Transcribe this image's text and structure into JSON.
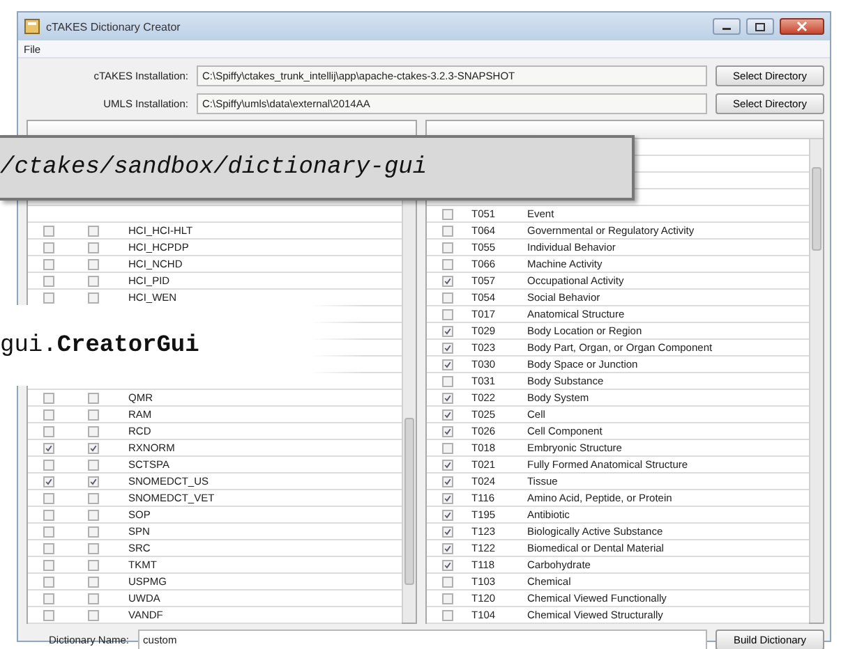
{
  "window": {
    "title": "cTAKES Dictionary Creator"
  },
  "menu": [
    "File"
  ],
  "installations": [
    {
      "label": "cTAKES Installation:",
      "value": "C:\\Spiffy\\ctakes_trunk_intellij\\app\\apache-ctakes-3.2.3-SNAPSHOT",
      "button": "Select Directory"
    },
    {
      "label": "UMLS Installation:",
      "value": "C:\\Spiffy\\umls\\data\\external\\2014AA",
      "button": "Select Directory"
    }
  ],
  "source_table": {
    "rows_upper": [
      {
        "name": "HCI_HCI-HLT",
        "checked_1": false,
        "checked_2": false
      },
      {
        "name": "HCI_HCPDP",
        "checked_1": false,
        "checked_2": false
      },
      {
        "name": "HCI_NCHD",
        "checked_1": false,
        "checked_2": false
      },
      {
        "name": "HCI_PID",
        "checked_1": false,
        "checked_2": false
      },
      {
        "name": "HCI_WEN",
        "checked_1": false,
        "checked_2": false
      }
    ],
    "rows_lower": [
      {
        "name": "QMR",
        "checked_1": false,
        "checked_2": false
      },
      {
        "name": "RAM",
        "checked_1": false,
        "checked_2": false
      },
      {
        "name": "RCD",
        "checked_1": false,
        "checked_2": false
      },
      {
        "name": "RXNORM",
        "checked_1": true,
        "checked_2": true
      },
      {
        "name": "SCTSPA",
        "checked_1": false,
        "checked_2": false
      },
      {
        "name": "SNOMEDCT_US",
        "checked_1": true,
        "checked_2": true
      },
      {
        "name": "SNOMEDCT_VET",
        "checked_1": false,
        "checked_2": false
      },
      {
        "name": "SOP",
        "checked_1": false,
        "checked_2": false
      },
      {
        "name": "SPN",
        "checked_1": false,
        "checked_2": false
      },
      {
        "name": "SRC",
        "checked_1": false,
        "checked_2": false
      },
      {
        "name": "TKMT",
        "checked_1": false,
        "checked_2": false
      },
      {
        "name": "USPMG",
        "checked_1": false,
        "checked_2": false
      },
      {
        "name": "UWDA",
        "checked_1": false,
        "checked_2": false
      },
      {
        "name": "VANDF",
        "checked_1": false,
        "checked_2": false
      }
    ]
  },
  "type_table": {
    "rows": [
      {
        "tui": "T051",
        "name": "Event",
        "checked": false
      },
      {
        "tui": "T064",
        "name": "Governmental or Regulatory Activity",
        "checked": false
      },
      {
        "tui": "T055",
        "name": "Individual Behavior",
        "checked": false
      },
      {
        "tui": "T066",
        "name": "Machine Activity",
        "checked": false
      },
      {
        "tui": "T057",
        "name": "Occupational Activity",
        "checked": true
      },
      {
        "tui": "T054",
        "name": "Social Behavior",
        "checked": false
      },
      {
        "tui": "T017",
        "name": "Anatomical Structure",
        "checked": false
      },
      {
        "tui": "T029",
        "name": "Body Location or Region",
        "checked": true
      },
      {
        "tui": "T023",
        "name": "Body Part, Organ, or Organ Component",
        "checked": true
      },
      {
        "tui": "T030",
        "name": "Body Space or Junction",
        "checked": true
      },
      {
        "tui": "T031",
        "name": "Body Substance",
        "checked": false
      },
      {
        "tui": "T022",
        "name": "Body System",
        "checked": true
      },
      {
        "tui": "T025",
        "name": "Cell",
        "checked": true
      },
      {
        "tui": "T026",
        "name": "Cell Component",
        "checked": true
      },
      {
        "tui": "T018",
        "name": "Embryonic Structure",
        "checked": false
      },
      {
        "tui": "T021",
        "name": "Fully Formed Anatomical Structure",
        "checked": true
      },
      {
        "tui": "T024",
        "name": "Tissue",
        "checked": true
      },
      {
        "tui": "T116",
        "name": "Amino Acid, Peptide, or Protein",
        "checked": true
      },
      {
        "tui": "T195",
        "name": "Antibiotic",
        "checked": true
      },
      {
        "tui": "T123",
        "name": "Biologically Active Substance",
        "checked": true
      },
      {
        "tui": "T122",
        "name": "Biomedical or Dental Material",
        "checked": true
      },
      {
        "tui": "T118",
        "name": "Carbohydrate",
        "checked": true
      },
      {
        "tui": "T103",
        "name": "Chemical",
        "checked": false
      },
      {
        "tui": "T120",
        "name": "Chemical Viewed Functionally",
        "checked": false
      },
      {
        "tui": "T104",
        "name": "Chemical Viewed Structurally",
        "checked": false
      }
    ]
  },
  "dictionary": {
    "label": "Dictionary Name:",
    "value": "custom",
    "button": "Build Dictionary"
  },
  "callouts": [
    {
      "kind": "path",
      "text": "/ctakes/sandbox/dictionary-gui"
    },
    {
      "kind": "class",
      "text": "gui.**CreatorGui**"
    }
  ]
}
